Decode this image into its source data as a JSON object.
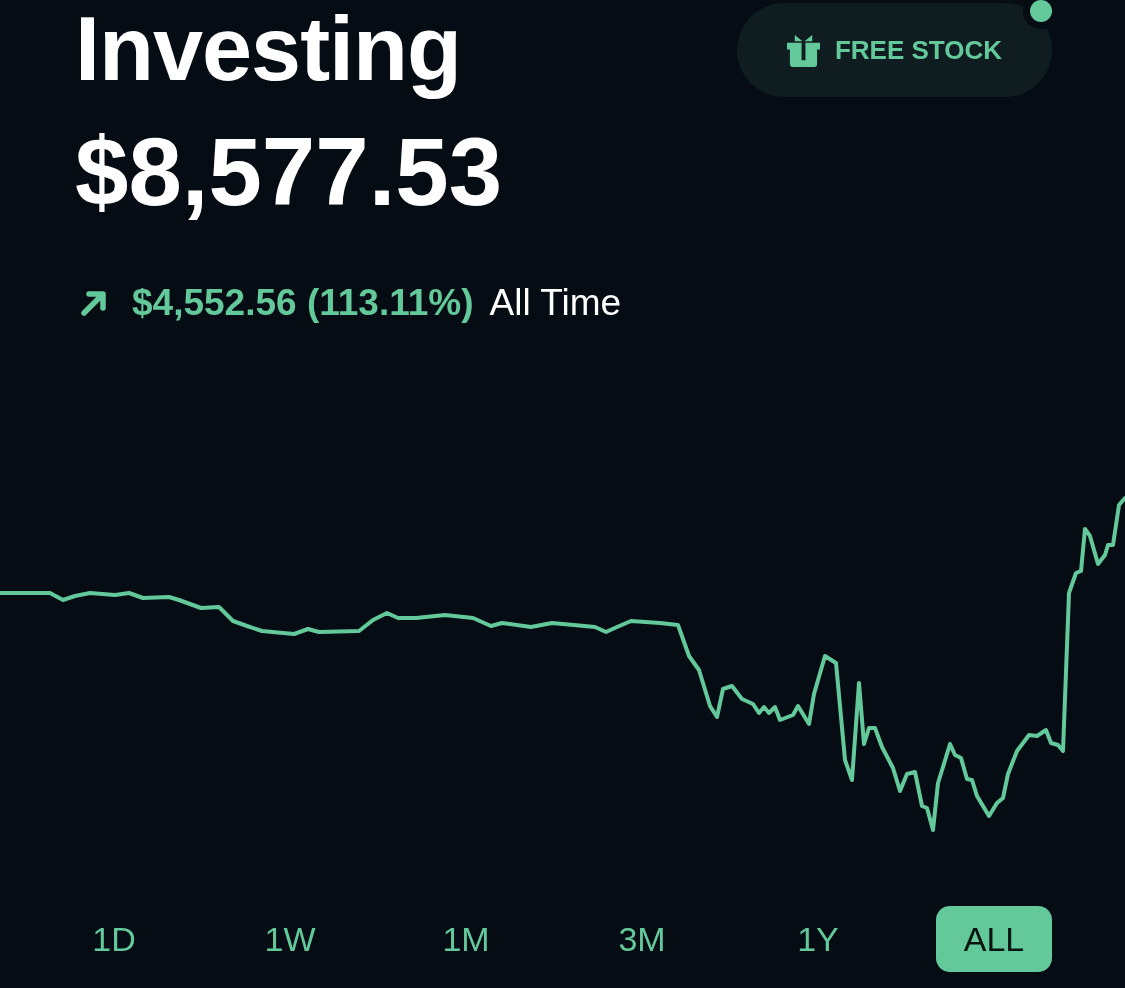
{
  "header": {
    "title": "Investing",
    "balance": "$8,577.53"
  },
  "promo": {
    "label": "FREE STOCK",
    "notification": true
  },
  "gain": {
    "positive": true,
    "amount": "$4,552.56 (113.11%)",
    "period": "All Time"
  },
  "ranges": [
    {
      "label": "1D",
      "selected": false
    },
    {
      "label": "1W",
      "selected": false
    },
    {
      "label": "1M",
      "selected": false
    },
    {
      "label": "3M",
      "selected": false
    },
    {
      "label": "1Y",
      "selected": false
    },
    {
      "label": "ALL",
      "selected": true
    }
  ]
}
